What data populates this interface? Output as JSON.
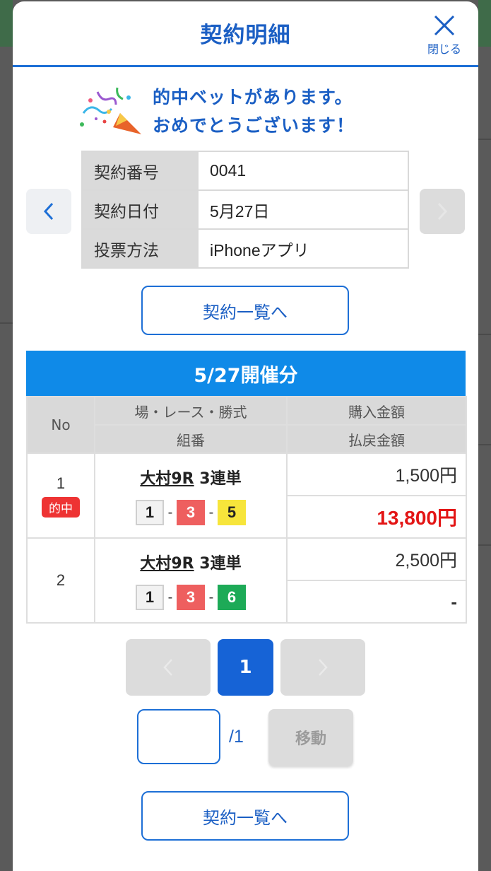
{
  "modal": {
    "title": "契約明細",
    "close_label": "閉じる"
  },
  "congrats": {
    "line1": "的中ベットがあります。",
    "line2": "おめでとうございます！"
  },
  "contract_info": [
    {
      "key": "契約番号",
      "value": "0041"
    },
    {
      "key": "契約日付",
      "value": "5月27日"
    },
    {
      "key": "投票方法",
      "value": "iPhoneアプリ"
    }
  ],
  "to_list_label": "契約一覧へ",
  "day_header": "5/27開催分",
  "bets_table": {
    "headers": {
      "no": "No",
      "race": "場・レース・勝式",
      "combination": "組番",
      "purchase": "購入金額",
      "payout": "払戻金額"
    },
    "rows": [
      {
        "no": "1",
        "badge": "的中",
        "venue_race": "大村9R",
        "bet_type": "3連単",
        "combo": [
          "1",
          "3",
          "5"
        ],
        "purchase": "1,500円",
        "payout": "13,800円"
      },
      {
        "no": "2",
        "badge": "",
        "venue_race": "大村9R",
        "bet_type": "3連単",
        "combo": [
          "1",
          "3",
          "6"
        ],
        "purchase": "2,500円",
        "payout": "-"
      }
    ]
  },
  "pagination": {
    "current_page": "1",
    "total": "/1",
    "move_label": "移動",
    "input_value": ""
  },
  "colors": {
    "primary": "#1d6fd6",
    "day_header_bg": "#0f8ae8",
    "win": "#e31515",
    "box_white": "#f2f2f2",
    "box_red": "#ee5f5f",
    "box_yellow": "#f7e53b",
    "box_green": "#1daa57"
  }
}
